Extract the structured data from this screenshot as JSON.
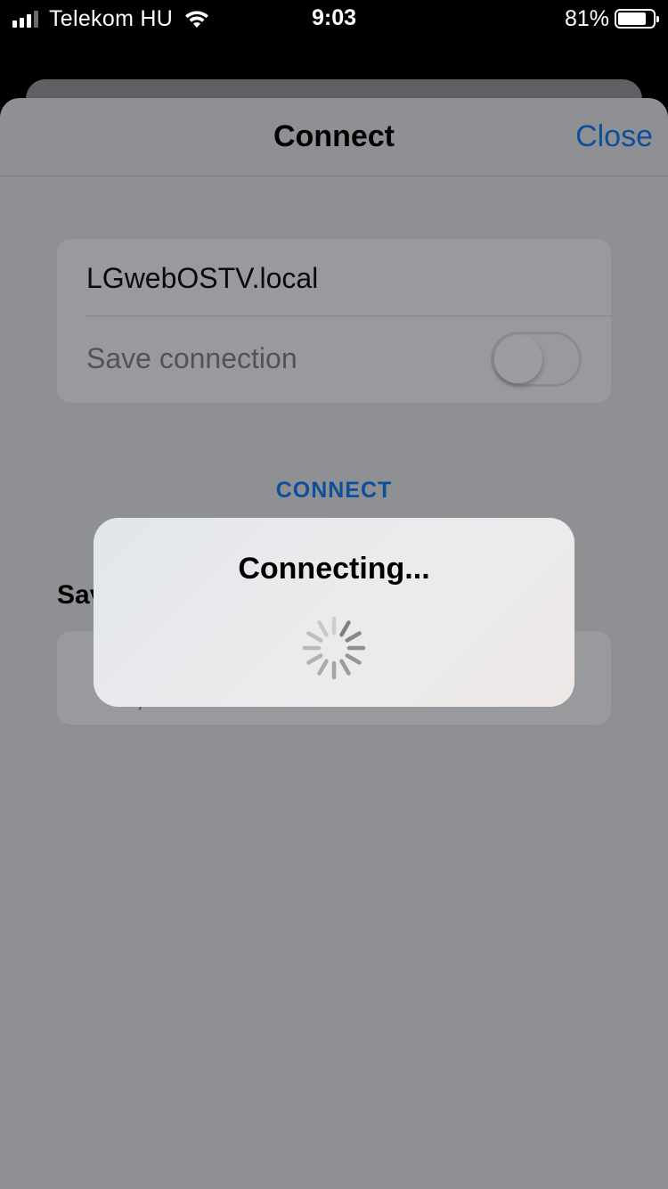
{
  "status_bar": {
    "carrier": "Telekom HU",
    "time": "9:03",
    "battery_percent": "81%",
    "battery_level": 0.81,
    "signal_bars": 3,
    "icons": [
      "signal-icon",
      "wifi-icon",
      "battery-icon"
    ]
  },
  "nav": {
    "title": "Connect",
    "close_label": "Close"
  },
  "form": {
    "host_value": "LGwebOSTV.local",
    "save_connection_label": "Save connection",
    "save_connection_on": false
  },
  "connect_button_label": "CONNECT",
  "saved_section": {
    "heading_visible": "Sav",
    "card_text_visible": "‚"
  },
  "alert": {
    "title": "Connecting...",
    "indicator": "spinner-icon"
  },
  "colors": {
    "accent": "#0c4f9b",
    "sheet_dimmed": "#8f9094",
    "alert_bg": "#ebebed"
  }
}
